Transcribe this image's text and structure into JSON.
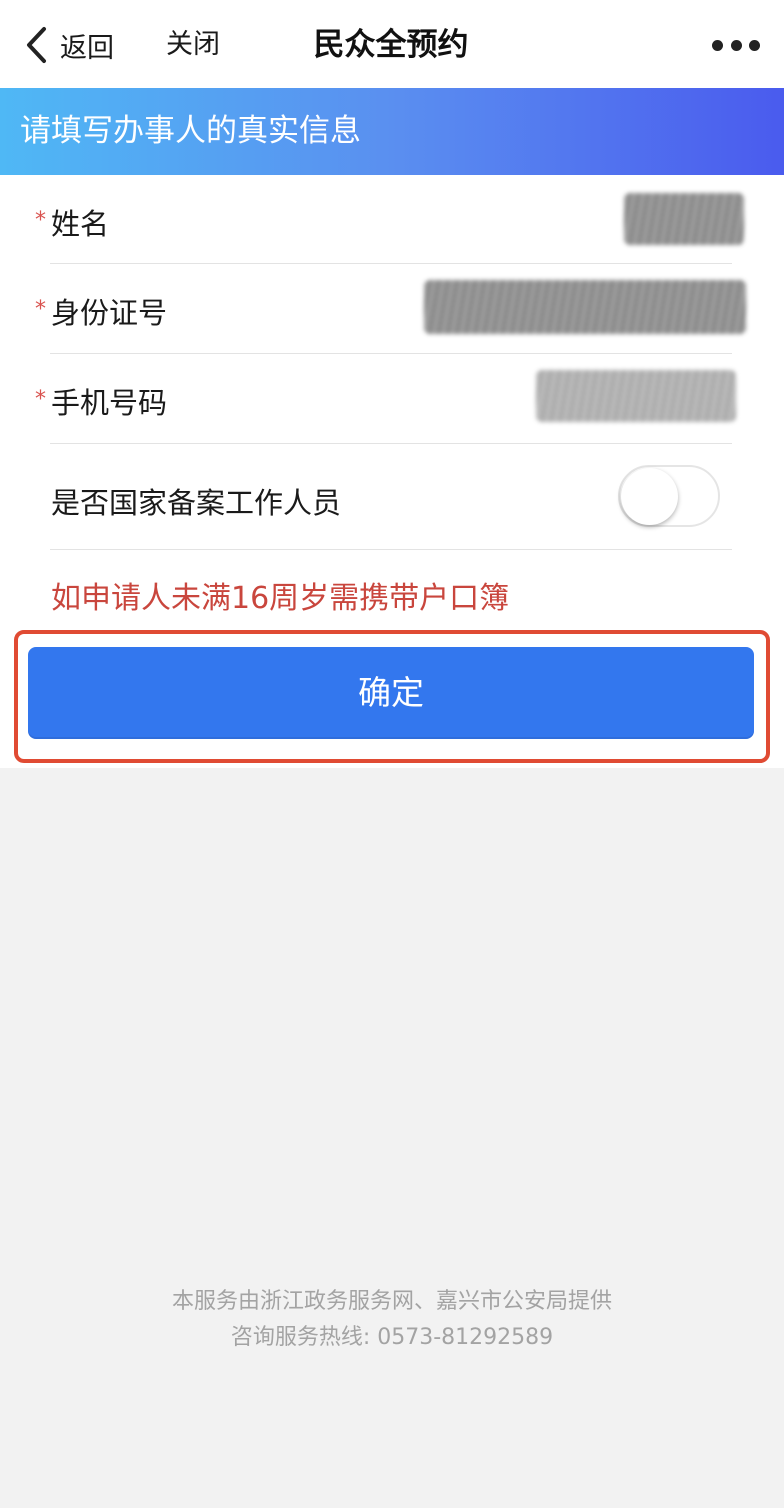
{
  "navbar": {
    "back_label": "返回",
    "close_label": "关闭",
    "title": "民众全预约",
    "back_icon": "chevron-left-icon",
    "more_icon": "more-dots-icon"
  },
  "banner": {
    "text": "请填写办事人的真实信息"
  },
  "form": {
    "required_mark": "*",
    "fields": [
      {
        "label": "姓名",
        "value": "[redacted]"
      },
      {
        "label": "身份证号",
        "value": "[redacted]"
      },
      {
        "label": "手机号码",
        "value": "[redacted]"
      }
    ],
    "toggle": {
      "label": "是否国家备案工作人员",
      "state": "off"
    },
    "notice": "如申请人未满16周岁需携带户口簿",
    "confirm_label": "确定"
  },
  "footer": {
    "line1": "本服务由浙江政务服务网、嘉兴市公安局提供",
    "line2": "咨询服务热线: 0573-81292589"
  },
  "colors": {
    "accent": "#3377ee",
    "notice": "#c9463d",
    "highlight": "#e04b33",
    "banner_start": "#4fb8f5",
    "banner_end": "#4a5bee"
  }
}
